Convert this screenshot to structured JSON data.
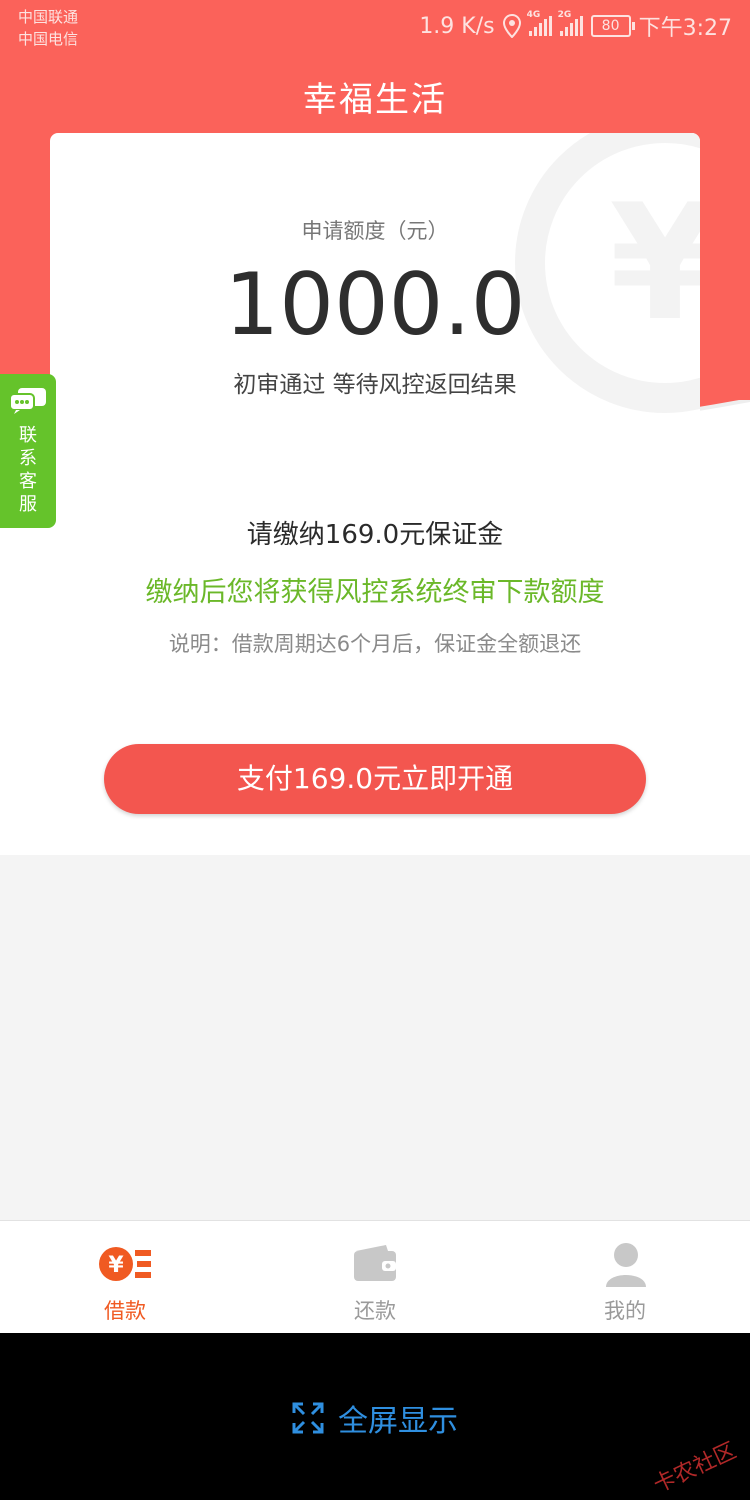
{
  "status_bar": {
    "carrier1": "中国联通",
    "carrier2": "中国电信",
    "speed": "1.9 K/s",
    "network1": "4G",
    "network2": "2G",
    "battery": "80",
    "time": "下午3:27"
  },
  "header": {
    "title": "幸福生活"
  },
  "card": {
    "label": "申请额度（元）",
    "amount": "1000.0",
    "status": "初审通过 等待风控返回结果",
    "bg_icon": "yen-icon"
  },
  "contact": {
    "label": "联系客服",
    "icon": "chat-icon"
  },
  "payment": {
    "title": "请缴纳169.0元保证金",
    "subtitle": "缴纳后您将获得风控系统终审下款额度",
    "note": "说明：借款周期达6个月后，保证金全额退还",
    "button_label": "支付169.0元立即开通"
  },
  "tabs": [
    {
      "label": "借款",
      "icon": "loan-icon",
      "active": true
    },
    {
      "label": "还款",
      "icon": "wallet-icon",
      "active": false
    },
    {
      "label": "我的",
      "icon": "user-icon",
      "active": false
    }
  ],
  "system": {
    "fullscreen_label": "全屏显示",
    "fullscreen_icon": "expand-icon",
    "watermark": "卡农社区"
  },
  "colors": {
    "primary": "#fb625a",
    "button": "#f3564f",
    "green": "#6bb829",
    "tab_active": "#f05a22",
    "link": "#2f8fe0"
  }
}
